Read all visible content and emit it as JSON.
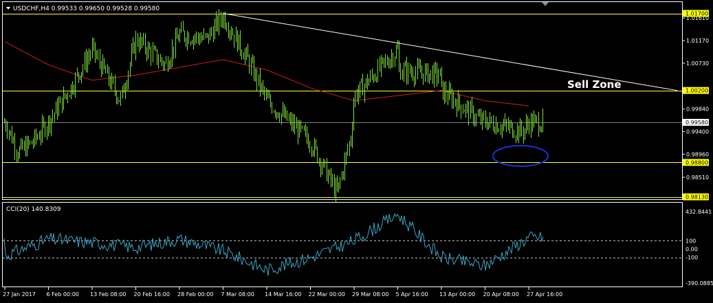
{
  "window": {
    "menu_arrow_icon": "triangle-down-icon",
    "header_label": "USDCHF,H4  0.99533 0.99650 0.99528 0.99580",
    "annotation_label": "Sell Zone"
  },
  "colors": {
    "background": "#000000",
    "frame": "#ffffff",
    "bull_candle": "#7fe033",
    "bear_candle": "#7fe033",
    "moving_average": "#cc1f1f",
    "horizontal_level": "#ffff33",
    "trendline": "#ffffff",
    "current_price_line": "#808080",
    "zone_ellipse": "#1e2fd6",
    "cci_line": "#39a6c4",
    "cci_levels": "#c0c0c0",
    "axis_text": "#ffffff",
    "price_tag_bg": "#ffff00",
    "price_tag_text": "#000000",
    "current_tag_bg": "#ffffff"
  },
  "price_axis": {
    "ticks": [
      "1.01610",
      "1.01170",
      "1.00730",
      "0.99840",
      "0.99400",
      "0.98960",
      "0.98510"
    ]
  },
  "price_levels": [
    {
      "label": "1.01700",
      "value": 1.017
    },
    {
      "label": "1.00200",
      "value": 1.002
    },
    {
      "label": "0.98800",
      "value": 0.988
    },
    {
      "label": "0.98130",
      "value": 0.9813
    }
  ],
  "current_price": {
    "label": "0.99580",
    "value": 0.9958
  },
  "cci_panel": {
    "header_label": "CCI(20) 140.8309",
    "max_label": "432.8441",
    "min_label": "-390.0885",
    "level_labels": [
      "100",
      "0.00",
      "-100"
    ],
    "levels": [
      100,
      0,
      -100
    ],
    "max_value": 432.8441,
    "min_value": -390.0885
  },
  "time_axis": {
    "labels": [
      "27 Jan 2017",
      "6 Feb 00:00",
      "13 Feb 08:00",
      "20 Feb 16:00",
      "28 Feb 00:00",
      "7 Mar 08:00",
      "14 Mar 16:00",
      "22 Mar 00:00",
      "29 Mar 08:00",
      "5 Apr 16:00",
      "13 Apr 00:00",
      "20 Apr 08:00",
      "27 Apr 16:00"
    ]
  },
  "chart_data": {
    "type": "candlestick",
    "symbol": "USDCHF",
    "timeframe": "H4",
    "close_path": [
      [
        "27 Jan 2017",
        0.996
      ],
      [
        "30 Jan 2017",
        0.99
      ],
      [
        "2 Feb 2017",
        0.992
      ],
      [
        "6 Feb 00:00",
        0.996
      ],
      [
        "9 Feb 2017",
        1.002
      ],
      [
        "13 Feb 08:00",
        1.01
      ],
      [
        "16 Feb 2017",
        1.0
      ],
      [
        "20 Feb 16:00",
        1.012
      ],
      [
        "24 Feb 2017",
        1.007
      ],
      [
        "28 Feb 00:00",
        1.013
      ],
      [
        "2 Mar 2017",
        1.012
      ],
      [
        "7 Mar 08:00",
        1.0165
      ],
      [
        "10 Mar 2017",
        1.008
      ],
      [
        "14 Mar 16:00",
        1.0
      ],
      [
        "17 Mar 2017",
        0.996
      ],
      [
        "22 Mar 00:00",
        0.992
      ],
      [
        "24 Mar 2017",
        0.982
      ],
      [
        "27 Mar 2017",
        0.993
      ],
      [
        "29 Mar 08:00",
        1.001
      ],
      [
        "3 Apr 2017",
        1.006
      ],
      [
        "5 Apr 16:00",
        1.01
      ],
      [
        "10 Apr 2017",
        1.005
      ],
      [
        "13 Apr 00:00",
        1.002
      ],
      [
        "18 Apr 2017",
        0.996
      ],
      [
        "20 Apr 08:00",
        0.996
      ],
      [
        "25 Apr 2017",
        0.994
      ],
      [
        "27 Apr 16:00",
        0.9958
      ]
    ],
    "moving_average_path": [
      [
        "27 Jan 2017",
        1.0115
      ],
      [
        "6 Feb 00:00",
        1.007
      ],
      [
        "13 Feb 08:00",
        1.004
      ],
      [
        "20 Feb 16:00",
        1.005
      ],
      [
        "28 Feb 00:00",
        1.0065
      ],
      [
        "7 Mar 08:00",
        1.008
      ],
      [
        "14 Mar 16:00",
        1.006
      ],
      [
        "22 Mar 00:00",
        1.0025
      ],
      [
        "29 Mar 08:00",
        1.0
      ],
      [
        "5 Apr 16:00",
        1.001
      ],
      [
        "13 Apr 00:00",
        1.002
      ],
      [
        "20 Apr 08:00",
        1.0
      ],
      [
        "27 Apr 16:00",
        0.999
      ]
    ],
    "trendline": {
      "from": [
        "7 Mar 08:00",
        1.017
      ],
      "to": [
        "1 May 2017",
        1.002
      ]
    },
    "cci_path": [
      [
        "27 Jan 2017",
        -80
      ],
      [
        "6 Feb 00:00",
        120
      ],
      [
        "13 Feb 08:00",
        80
      ],
      [
        "20 Feb 16:00",
        20
      ],
      [
        "28 Feb 00:00",
        120
      ],
      [
        "7 Mar 08:00",
        -20
      ],
      [
        "14 Mar 16:00",
        -250
      ],
      [
        "22 Mar 00:00",
        -100
      ],
      [
        "29 Mar 08:00",
        100
      ],
      [
        "5 Apr 16:00",
        420
      ],
      [
        "13 Apr 00:00",
        -100
      ],
      [
        "20 Apr 08:00",
        -200
      ],
      [
        "27 Apr 16:00",
        140.83
      ]
    ]
  }
}
